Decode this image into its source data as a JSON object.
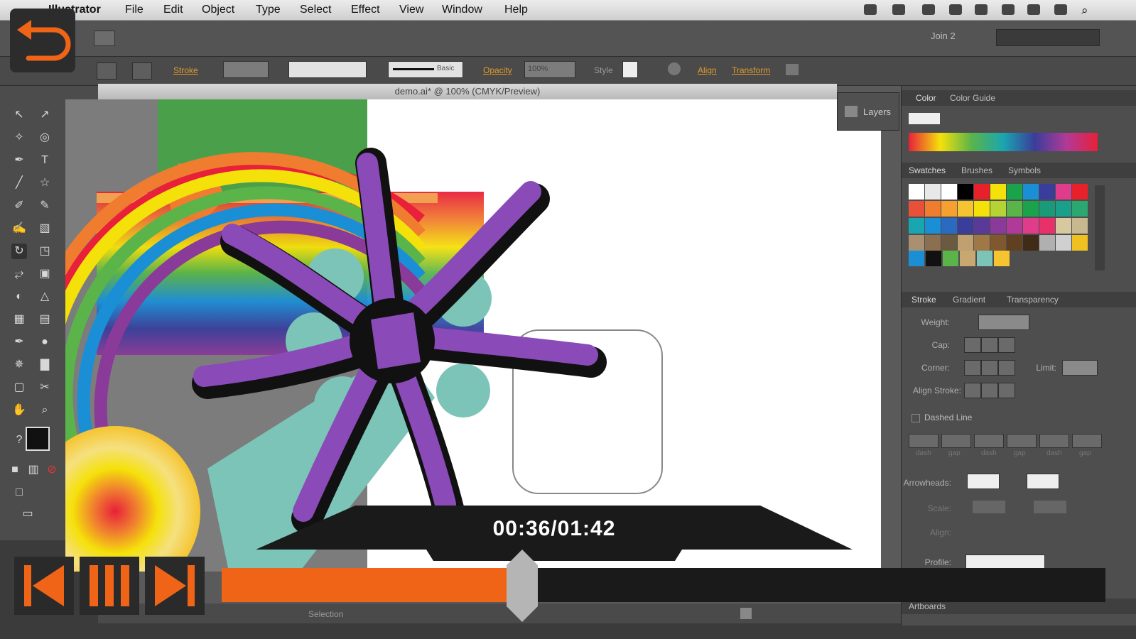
{
  "menubar": {
    "app_name": "Illustrator",
    "items": [
      "File",
      "Edit",
      "Object",
      "Type",
      "Select",
      "Effect",
      "View",
      "Window",
      "Help"
    ]
  },
  "appbar": {
    "workspace": "Join 2"
  },
  "control_bar": {
    "stroke_label": "Stroke",
    "stroke_profile": "Basic",
    "opacity_label": "Opacity",
    "opacity_value": "100%",
    "style_label": "Style",
    "align_label": "Align",
    "transform_label": "Transform"
  },
  "document": {
    "tab_title": "demo.ai* @ 100% (CMYK/Preview)"
  },
  "layers_panel": {
    "label": "Layers"
  },
  "color_panel": {
    "tabs": [
      "Color",
      "Color Guide"
    ]
  },
  "swatches_panel": {
    "tabs": [
      "Swatches",
      "Brushes",
      "Symbols"
    ],
    "rows": [
      [
        "#ffffff",
        "#e8e8e8",
        "#ffffff",
        "#000000",
        "#e8202a",
        "#f5e10a",
        "#1aa34a",
        "#1b8fd6",
        "#3a3d9a",
        "#e03c8c",
        "#e8202a"
      ],
      [
        "#e8503a",
        "#f07c30",
        "#f5a030",
        "#f5c430",
        "#f5e10a",
        "#b5d334",
        "#5ab44a",
        "#1aa34a",
        "#1b9a7a",
        "#1aa08a",
        "#2aa870"
      ],
      [
        "#1aa6b0",
        "#1b8fd6",
        "#2a6ac0",
        "#3a3d9a",
        "#5a3a98",
        "#8a3a98",
        "#b03a98",
        "#e03c8c",
        "#e8306a",
        "#d8c8a0",
        "#c8b890"
      ],
      [
        "#a89070",
        "#8a7050",
        "#6a5a40",
        "#c0a070",
        "#a07848",
        "#805830",
        "#604020",
        "#402a18",
        "#b0b0b0",
        "#d0d0d0",
        "#f0c020"
      ]
    ]
  },
  "stroke_panel": {
    "tabs": [
      "Stroke",
      "Gradient",
      "Transparency"
    ],
    "weight_label": "Weight:",
    "cap_label": "Cap:",
    "corner_label": "Corner:",
    "limit_label": "Limit:",
    "align_label": "Align Stroke:",
    "dashed_label": "Dashed Line",
    "dash_labels": [
      "dash",
      "gap",
      "dash",
      "gap",
      "dash",
      "gap"
    ],
    "arrowheads_label": "Arrowheads:",
    "scale_label": "Scale:",
    "align2_label": "Align:",
    "profile_label": "Profile:",
    "artboards_label": "Artboards"
  },
  "status_bar": {
    "tool": "Selection"
  },
  "player": {
    "time": "00:36/01:42",
    "progress": 0.34,
    "accent": "#f06418"
  }
}
